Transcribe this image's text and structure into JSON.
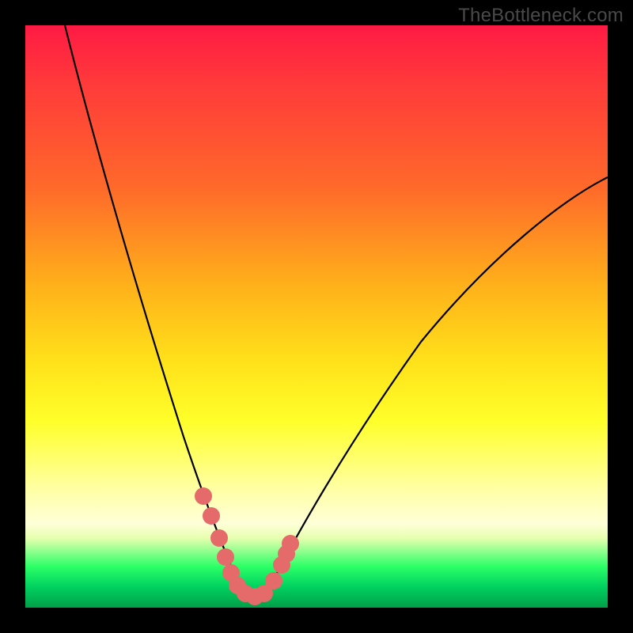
{
  "watermark": "TheBottleneck.com",
  "chart_data": {
    "type": "line",
    "title": "",
    "xlabel": "",
    "ylabel": "",
    "xlim": [
      0,
      100
    ],
    "ylim": [
      0,
      100
    ],
    "series": [
      {
        "name": "bottleneck-curve",
        "x": [
          7,
          10,
          14,
          18,
          22,
          26,
          29,
          31,
          33,
          35,
          36,
          37,
          38,
          39,
          40,
          41,
          43,
          45,
          48,
          52,
          58,
          66,
          76,
          88,
          100
        ],
        "values": [
          100,
          89,
          76,
          64,
          52,
          40,
          30,
          22,
          15,
          9,
          6,
          4,
          2.5,
          2,
          2,
          2.5,
          5,
          9,
          15,
          23,
          33,
          44,
          54,
          63,
          70
        ]
      },
      {
        "name": "highlight-near-minimum",
        "x": [
          31,
          33,
          34,
          35,
          36,
          37,
          38,
          39,
          40,
          41,
          43,
          44,
          45
        ],
        "values": [
          22,
          15,
          12,
          9,
          6,
          4,
          2.5,
          2,
          2,
          2.5,
          5,
          7,
          9
        ]
      }
    ],
    "colors": {
      "curve": "#000000",
      "highlight": "#e86a6a",
      "background_top": "#ff1a44",
      "background_mid": "#ffe21a",
      "background_bottom": "#00a048"
    }
  }
}
